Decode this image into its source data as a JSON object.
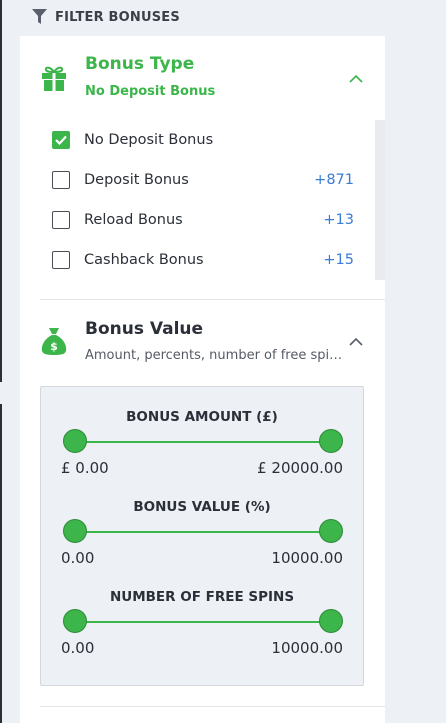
{
  "header": {
    "label": "FILTER BONUSES",
    "icon": "filter-icon"
  },
  "colors": {
    "accent": "#3cb54a",
    "link": "#3a7bd5",
    "background": "#edf0f5"
  },
  "bonus_type": {
    "icon": "gift-icon",
    "title": "Bonus Type",
    "subtitle": "No Deposit Bonus",
    "options": [
      {
        "label": "No Deposit Bonus",
        "checked": true,
        "count": ""
      },
      {
        "label": "Deposit Bonus",
        "checked": false,
        "count": "+871"
      },
      {
        "label": "Reload Bonus",
        "checked": false,
        "count": "+13"
      },
      {
        "label": "Cashback Bonus",
        "checked": false,
        "count": "+15"
      }
    ]
  },
  "bonus_value": {
    "icon": "money-bag-icon",
    "title": "Bonus Value",
    "subtitle": "Amount, percents, number of free spins",
    "ranges": [
      {
        "title": "BONUS AMOUNT (£)",
        "min": "£ 0.00",
        "max": "£ 20000.00"
      },
      {
        "title": "BONUS VALUE (%)",
        "min": "0.00",
        "max": "10000.00"
      },
      {
        "title": "NUMBER OF FREE SPINS",
        "min": "0.00",
        "max": "10000.00"
      }
    ]
  }
}
